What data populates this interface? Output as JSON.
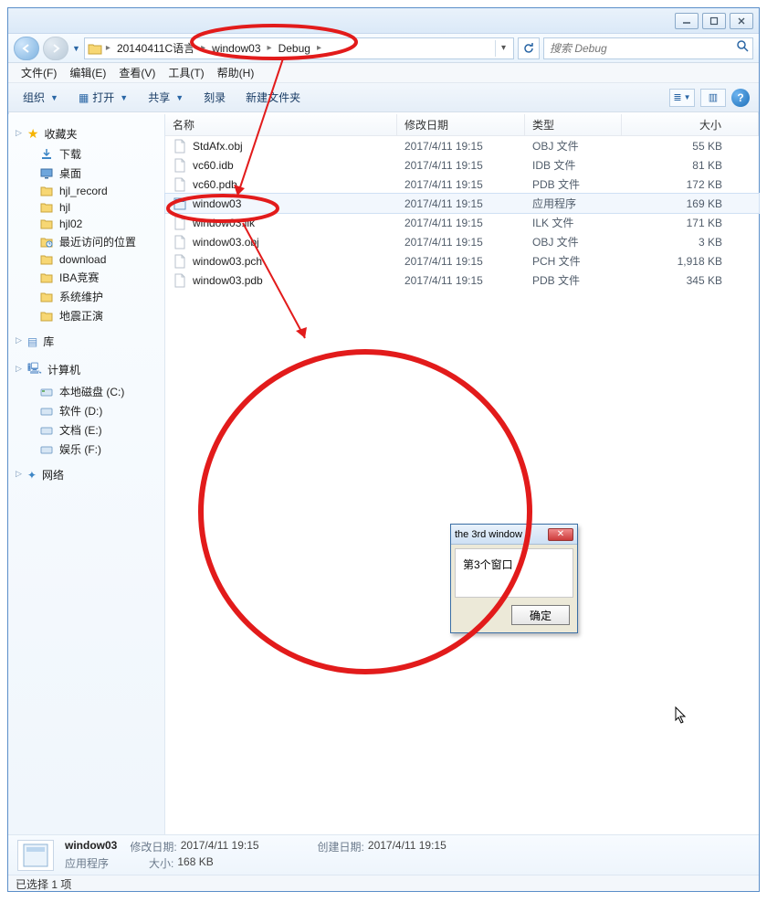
{
  "titlebar": {
    "min": "_",
    "max": "❐",
    "close": "✕"
  },
  "nav": {
    "breadcrumb": [
      "20140411C语言",
      "window03",
      "Debug"
    ],
    "search_placeholder": "搜索 Debug"
  },
  "menu": {
    "file": "文件(F)",
    "edit": "编辑(E)",
    "view": "查看(V)",
    "tools": "工具(T)",
    "help": "帮助(H)"
  },
  "toolbar": {
    "organize": "组织",
    "open": "打开",
    "share": "共享",
    "burn": "刻录",
    "newfolder": "新建文件夹"
  },
  "sidebar": {
    "favorites_head": "收藏夹",
    "favorites": [
      {
        "icon": "download-icon",
        "label": "下载"
      },
      {
        "icon": "desktop-icon",
        "label": "桌面"
      },
      {
        "icon": "folder-icon",
        "label": "hjl_record"
      },
      {
        "icon": "folder-icon",
        "label": "hjl"
      },
      {
        "icon": "folder-icon",
        "label": "hjl02"
      },
      {
        "icon": "recent-icon",
        "label": "最近访问的位置"
      },
      {
        "icon": "folder-icon",
        "label": "download"
      },
      {
        "icon": "folder-icon",
        "label": "IBA竞赛"
      },
      {
        "icon": "folder-icon",
        "label": "系统维护"
      },
      {
        "icon": "folder-icon",
        "label": "地震正演"
      }
    ],
    "libraries_head": "库",
    "computer_head": "计算机",
    "drives": [
      {
        "icon": "drive-c-icon",
        "label": "本地磁盘 (C:)"
      },
      {
        "icon": "drive-icon",
        "label": "软件 (D:)"
      },
      {
        "icon": "drive-icon",
        "label": "文档 (E:)"
      },
      {
        "icon": "drive-icon",
        "label": "娱乐 (F:)"
      }
    ],
    "network_head": "网络"
  },
  "columns": {
    "name": "名称",
    "date": "修改日期",
    "type": "类型",
    "size": "大小"
  },
  "files": [
    {
      "name": "StdAfx.obj",
      "date": "2017/4/11 19:15",
      "type": "OBJ 文件",
      "size": "55 KB",
      "sel": false,
      "kind": "obj"
    },
    {
      "name": "vc60.idb",
      "date": "2017/4/11 19:15",
      "type": "IDB 文件",
      "size": "81 KB",
      "sel": false,
      "kind": "file"
    },
    {
      "name": "vc60.pdb",
      "date": "2017/4/11 19:15",
      "type": "PDB 文件",
      "size": "172 KB",
      "sel": false,
      "kind": "file"
    },
    {
      "name": "window03",
      "date": "2017/4/11 19:15",
      "type": "应用程序",
      "size": "169 KB",
      "sel": true,
      "kind": "exe"
    },
    {
      "name": "window03.ilk",
      "date": "2017/4/11 19:15",
      "type": "ILK 文件",
      "size": "171 KB",
      "sel": false,
      "kind": "file"
    },
    {
      "name": "window03.obj",
      "date": "2017/4/11 19:15",
      "type": "OBJ 文件",
      "size": "3 KB",
      "sel": false,
      "kind": "obj"
    },
    {
      "name": "window03.pch",
      "date": "2017/4/11 19:15",
      "type": "PCH 文件",
      "size": "1,918 KB",
      "sel": false,
      "kind": "file"
    },
    {
      "name": "window03.pdb",
      "date": "2017/4/11 19:15",
      "type": "PDB 文件",
      "size": "345 KB",
      "sel": false,
      "kind": "file"
    }
  ],
  "details": {
    "name": "window03",
    "type": "应用程序",
    "modlabel": "修改日期:",
    "mod": "2017/4/11 19:15",
    "createdlabel": "创建日期:",
    "created": "2017/4/11 19:15",
    "sizelabel": "大小:",
    "size": "168 KB"
  },
  "status": "已选择 1 项",
  "dialog": {
    "title": "the 3rd window",
    "body": "第3个窗口",
    "ok": "确定"
  }
}
